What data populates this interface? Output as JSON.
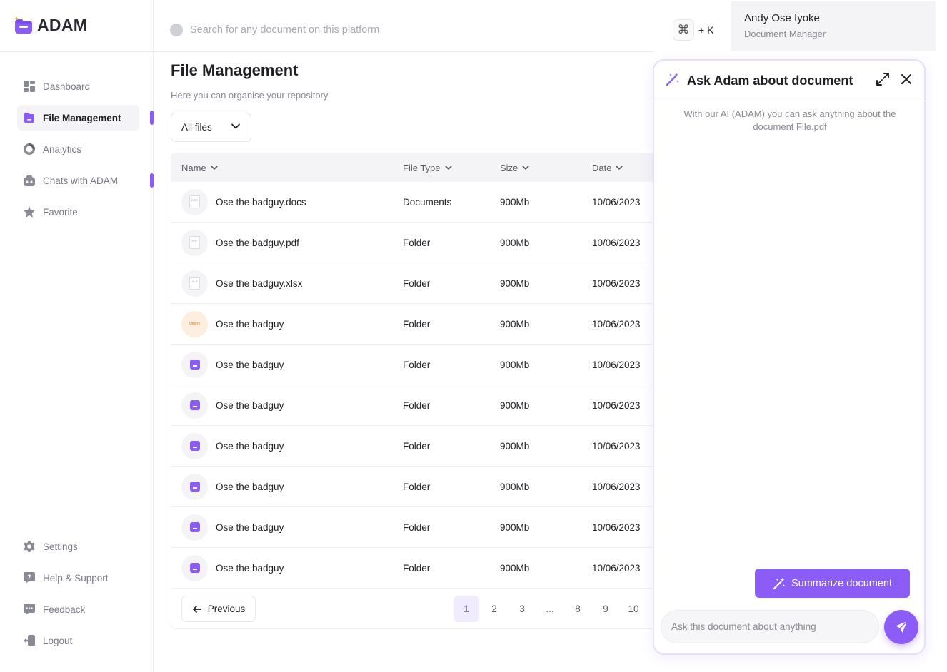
{
  "app": {
    "name": "ADAM"
  },
  "sidebar": {
    "items": [
      {
        "label": "Dashboard",
        "icon": "dashboard-icon"
      },
      {
        "label": "File Management",
        "icon": "folder-icon",
        "active": true
      },
      {
        "label": "Analytics",
        "icon": "analytics-icon"
      },
      {
        "label": "Chats with ADAM",
        "icon": "chat-bot-icon"
      },
      {
        "label": "Favorite",
        "icon": "star-icon"
      }
    ],
    "bottom_items": [
      {
        "label": "Settings",
        "icon": "gear-icon"
      },
      {
        "label": "Help & Support",
        "icon": "help-icon"
      },
      {
        "label": "Feedback",
        "icon": "feedback-icon"
      },
      {
        "label": "Logout",
        "icon": "logout-icon"
      }
    ]
  },
  "header": {
    "search_placeholder": "Search for any document on this platform",
    "shortcut_symbol": "⌘",
    "shortcut_text": "+ K",
    "user": {
      "name": "Andy Ose Iyoke",
      "role": "Document Manager"
    }
  },
  "main": {
    "title": "File Management",
    "subtitle": "Here you can organise your repository",
    "filter_value": "All files",
    "columns": {
      "name": "Name",
      "type": "File Type",
      "size": "Size",
      "date": "Date"
    },
    "rows": [
      {
        "name": "Ose the badguy.docs",
        "type": "Documents",
        "size": "900Mb",
        "date": "10/06/2023",
        "icon": "doc-file-icon",
        "icon_label": "DOC"
      },
      {
        "name": "Ose the badguy.pdf",
        "type": "Folder",
        "size": "900Mb",
        "date": "10/06/2023",
        "icon": "pdf-file-icon",
        "icon_label": "PDF"
      },
      {
        "name": "Ose the badguy.xlsx",
        "type": "Folder",
        "size": "900Mb",
        "date": "10/06/2023",
        "icon": "xlsx-file-icon",
        "icon_label": "XLS"
      },
      {
        "name": "Ose the badguy",
        "type": "Folder",
        "size": "900Mb",
        "date": "10/06/2023",
        "icon": "others-file-icon",
        "icon_label": "Others"
      },
      {
        "name": "Ose the badguy",
        "type": "Folder",
        "size": "900Mb",
        "date": "10/06/2023",
        "icon": "folder-icon"
      },
      {
        "name": "Ose the badguy",
        "type": "Folder",
        "size": "900Mb",
        "date": "10/06/2023",
        "icon": "folder-icon"
      },
      {
        "name": "Ose the badguy",
        "type": "Folder",
        "size": "900Mb",
        "date": "10/06/2023",
        "icon": "folder-icon"
      },
      {
        "name": "Ose the badguy",
        "type": "Folder",
        "size": "900Mb",
        "date": "10/06/2023",
        "icon": "folder-icon"
      },
      {
        "name": "Ose the badguy",
        "type": "Folder",
        "size": "900Mb",
        "date": "10/06/2023",
        "icon": "folder-icon"
      },
      {
        "name": "Ose the badguy",
        "type": "Folder",
        "size": "900Mb",
        "date": "10/06/2023",
        "icon": "folder-icon"
      }
    ],
    "pagination": {
      "previous_label": "Previous",
      "pages": [
        "1",
        "2",
        "3",
        "...",
        "8",
        "9",
        "10"
      ],
      "current": "1"
    }
  },
  "chat": {
    "title": "Ask Adam about document",
    "intro": "With our AI (ADAM) you can ask anything about the document File.pdf",
    "summarize_label": "Summarize document",
    "input_placeholder": "Ask this document about anything"
  },
  "colors": {
    "accent": "#8b5cf6",
    "accent_light": "#f1ecfd",
    "panel_border": "#e7dffc",
    "surface": "#f4f4f6"
  }
}
